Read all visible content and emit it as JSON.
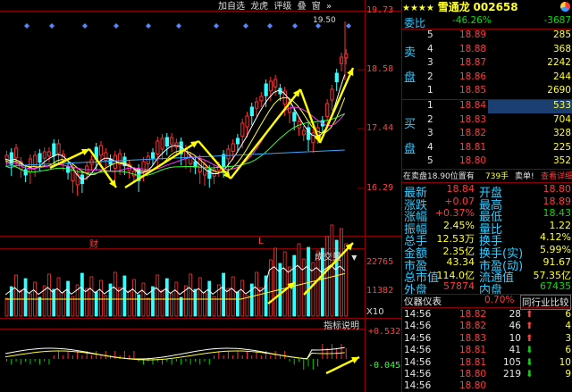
{
  "toolbar": {
    "add_watch": "加自选",
    "lhb": "龙虎",
    "rating": "评级",
    "overlay": "叠",
    "window": "窗",
    "expand": "»"
  },
  "main_chart": {
    "price_ticks": [
      "19.73",
      "18.58",
      "17.44",
      "16.29"
    ],
    "high_label": "19.50",
    "marker_cai": "财",
    "marker_l": "L",
    "volume_label": "成交量",
    "volume_ticks": [
      "22765",
      "11382"
    ],
    "volume_unit": "X10",
    "indicator_btn": "指标说明",
    "macd_ticks": [
      "+0.532",
      "-0.045"
    ]
  },
  "stock": {
    "stars": "★★★★",
    "name": "雪通龙",
    "code": "002658"
  },
  "weibi": {
    "label": "委比",
    "pct": "-46.26%",
    "diff": "-3687"
  },
  "side_labels": {
    "sell": [
      "卖",
      "盘"
    ],
    "buy": [
      "买",
      "盘"
    ]
  },
  "asks": [
    {
      "n": "5",
      "price": "18.89",
      "vol": "285"
    },
    {
      "n": "4",
      "price": "18.88",
      "vol": "368"
    },
    {
      "n": "3",
      "price": "18.87",
      "vol": "2242"
    },
    {
      "n": "2",
      "price": "18.86",
      "vol": "244"
    },
    {
      "n": "1",
      "price": "18.85",
      "vol": "2690"
    }
  ],
  "bids": [
    {
      "n": "1",
      "price": "18.84",
      "vol": "533"
    },
    {
      "n": "2",
      "price": "18.83",
      "vol": "704"
    },
    {
      "n": "3",
      "price": "18.82",
      "vol": "328"
    },
    {
      "n": "4",
      "price": "18.81",
      "vol": "225"
    },
    {
      "n": "5",
      "price": "18.80",
      "vol": "352"
    }
  ],
  "notice": {
    "text": "在卖盘18.90位置有",
    "vol": "739手",
    "buy": "卖单!",
    "detail": "查看详细"
  },
  "quote": [
    {
      "l1": "最新",
      "v1": "18.84",
      "l2": "开盘",
      "v2": "18.80"
    },
    {
      "l1": "涨跌",
      "v1": "+0.07",
      "l2": "最高",
      "v2": "18.89"
    },
    {
      "l1": "涨幅",
      "v1": "+0.37%",
      "l2": "最低",
      "v2": "18.43"
    },
    {
      "l1": "振幅",
      "v1": "2.45%",
      "l2": "量比",
      "v2": "1.22"
    },
    {
      "l1": "总手",
      "v1": "12.53万",
      "l2": "换手",
      "v2": "4.12%"
    },
    {
      "l1": "金额",
      "v1": "2.35亿",
      "l2": "换手(实)",
      "v2": "5.99%"
    },
    {
      "l1": "市盈",
      "v1": "43.34",
      "l2": "市盈(动)",
      "v2": "91.67"
    },
    {
      "l1": "总市值",
      "v1": "114.0亿",
      "l2": "流通值",
      "v2": "57.35亿"
    },
    {
      "l1": "外盘",
      "v1": "57874",
      "l2": "内盘",
      "v2": "67435"
    }
  ],
  "instrument": {
    "label": "仪器仪表",
    "pct": "0.70%",
    "compare": "同行业比较"
  },
  "ticks": [
    {
      "t": "14:56",
      "p": "18.82",
      "v": "28",
      "d": "up",
      "n": "6"
    },
    {
      "t": "14:56",
      "p": "18.82",
      "v": "46",
      "d": "up",
      "n": "4"
    },
    {
      "t": "14:56",
      "p": "18.83",
      "v": "10",
      "d": "up",
      "n": "3"
    },
    {
      "t": "14:56",
      "p": "18.81",
      "v": "41",
      "d": "down",
      "n": "6"
    },
    {
      "t": "14:56",
      "p": "18.81",
      "v": "105",
      "d": "down",
      "n": "10"
    },
    {
      "t": "14:56",
      "p": "18.80",
      "v": "219",
      "d": "down",
      "n": "9"
    },
    {
      "t": "14:56",
      "p": "18.80",
      "v": "",
      "d": "",
      "n": ""
    }
  ]
}
